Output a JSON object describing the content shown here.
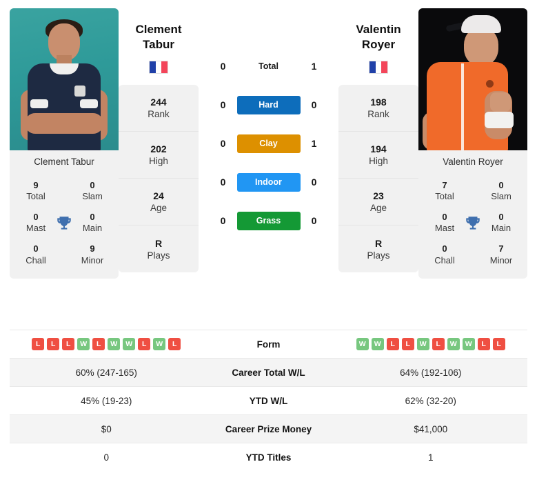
{
  "players": {
    "left": {
      "first_name": "Clement",
      "last_name": "Tabur",
      "full_name": "Clement Tabur",
      "country": "France",
      "flag_colors": [
        "#2040a8",
        "#ffffff",
        "#f3455a"
      ],
      "rank": "244",
      "rank_label": "Rank",
      "high": "202",
      "high_label": "High",
      "age": "24",
      "age_label": "Age",
      "plays": "R",
      "plays_label": "Plays",
      "titles": {
        "total": "9",
        "total_label": "Total",
        "slam": "0",
        "slam_label": "Slam",
        "mast": "0",
        "mast_label": "Mast",
        "main": "0",
        "main_label": "Main",
        "chall": "0",
        "chall_label": "Chall",
        "minor": "9",
        "minor_label": "Minor"
      },
      "form": [
        "L",
        "L",
        "L",
        "W",
        "L",
        "W",
        "W",
        "L",
        "W",
        "L"
      ],
      "career_total_wl": "60% (247-165)",
      "ytd_wl": "45% (19-23)",
      "career_prize_money": "$0",
      "ytd_titles": "0"
    },
    "right": {
      "first_name": "Valentin",
      "last_name": "Royer",
      "full_name": "Valentin Royer",
      "country": "France",
      "flag_colors": [
        "#2040a8",
        "#ffffff",
        "#f3455a"
      ],
      "rank": "198",
      "rank_label": "Rank",
      "high": "194",
      "high_label": "High",
      "age": "23",
      "age_label": "Age",
      "plays": "R",
      "plays_label": "Plays",
      "titles": {
        "total": "7",
        "total_label": "Total",
        "slam": "0",
        "slam_label": "Slam",
        "mast": "0",
        "mast_label": "Mast",
        "main": "0",
        "main_label": "Main",
        "chall": "0",
        "chall_label": "Chall",
        "minor": "7",
        "minor_label": "Minor"
      },
      "form": [
        "W",
        "W",
        "L",
        "L",
        "W",
        "L",
        "W",
        "W",
        "L",
        "L"
      ],
      "career_total_wl": "64% (192-106)",
      "ytd_wl": "62% (32-20)",
      "career_prize_money": "$41,000",
      "ytd_titles": "1"
    }
  },
  "head_to_head": [
    {
      "label": "Total",
      "left": "0",
      "right": "1",
      "style": "plain",
      "color": ""
    },
    {
      "label": "Hard",
      "left": "0",
      "right": "0",
      "style": "surface",
      "color": "#0d6dbb"
    },
    {
      "label": "Clay",
      "left": "0",
      "right": "1",
      "style": "surface",
      "color": "#dd9000"
    },
    {
      "label": "Indoor",
      "left": "0",
      "right": "0",
      "style": "surface",
      "color": "#2196f3"
    },
    {
      "label": "Grass",
      "left": "0",
      "right": "0",
      "style": "surface",
      "color": "#149935"
    }
  ],
  "stats_table": [
    {
      "label": "Form",
      "left": "",
      "right": "",
      "type": "form"
    },
    {
      "label": "Career Total W/L",
      "left": "60% (247-165)",
      "right": "64% (192-106)",
      "type": "text"
    },
    {
      "label": "YTD W/L",
      "left": "45% (19-23)",
      "right": "62% (32-20)",
      "type": "text"
    },
    {
      "label": "Career Prize Money",
      "left": "$0",
      "right": "$41,000",
      "type": "text"
    },
    {
      "label": "YTD Titles",
      "left": "0",
      "right": "1",
      "type": "text"
    }
  ],
  "icons": {
    "trophy": "trophy-icon",
    "flag": "flag-france-icon"
  },
  "colors": {
    "hard": "#0d6dbb",
    "clay": "#dd9000",
    "indoor": "#2196f3",
    "grass": "#149935",
    "win": "#77c77f",
    "loss": "#ef4f42",
    "card_bg": "#f1f1f1",
    "row_alt_bg": "#f4f4f4",
    "trophy_blue": "#3f6fae"
  }
}
